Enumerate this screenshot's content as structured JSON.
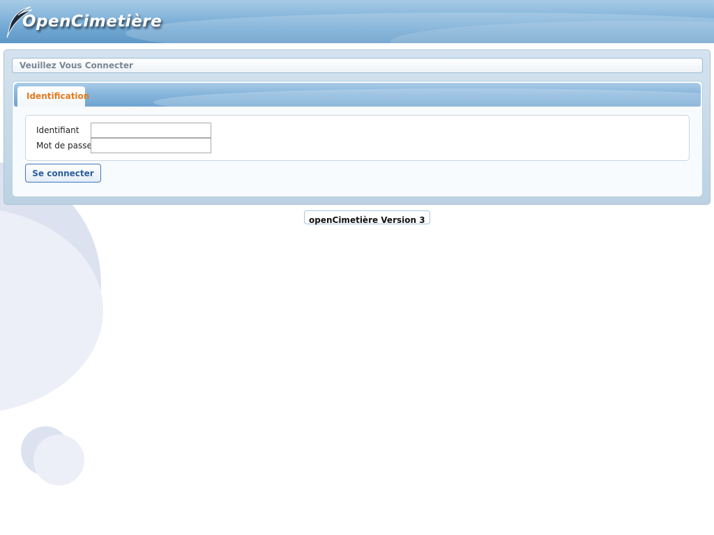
{
  "header": {
    "logo_text": "OpenCimetière"
  },
  "login": {
    "title": "Veuillez Vous Connecter",
    "tab_label": "Identification",
    "username_label": "Identifiant",
    "username_value": "",
    "password_label": "Mot de passe",
    "password_value": "",
    "submit_label": "Se connecter"
  },
  "footer": {
    "version_text": "openCimetière Version 3"
  },
  "colors": {
    "header_blue": "#6ea6d2",
    "tab_text_orange": "#e37a1e",
    "button_text_blue": "#2b5e9a"
  }
}
